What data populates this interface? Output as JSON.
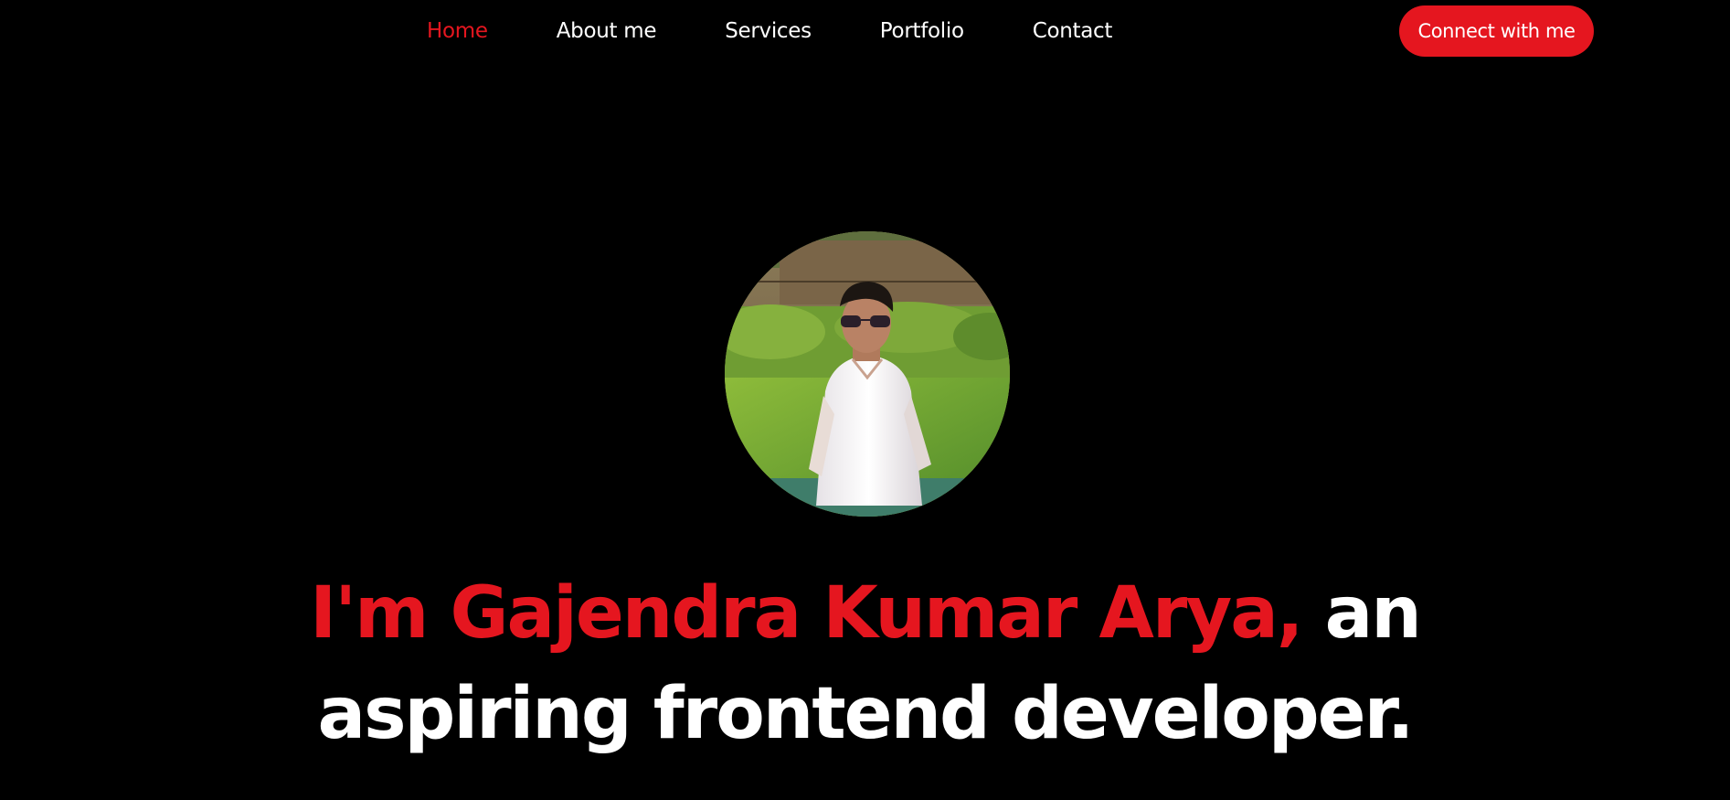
{
  "nav": {
    "items": [
      {
        "label": "Home",
        "active": true
      },
      {
        "label": "About me",
        "active": false
      },
      {
        "label": "Services",
        "active": false
      },
      {
        "label": "Portfolio",
        "active": false
      },
      {
        "label": "Contact",
        "active": false
      }
    ],
    "cta_label": "Connect with me"
  },
  "hero": {
    "name_part": "I'm Gajendra Kumar Arya,",
    "line1_rest": " an",
    "line2": "aspiring frontend developer."
  },
  "colors": {
    "background": "#000000",
    "accent": "#e5161f",
    "text": "#ffffff"
  },
  "icons": {
    "avatar": "profile-photo"
  }
}
